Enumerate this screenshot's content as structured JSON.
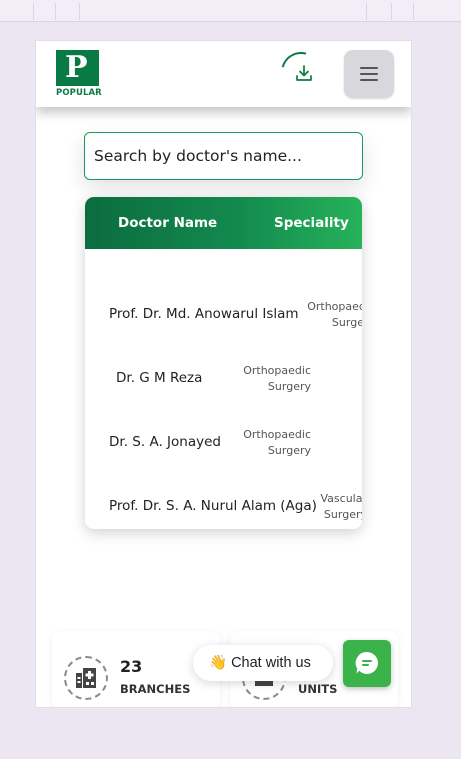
{
  "header": {
    "logo_text": "POPULAR",
    "download_icon": "download-icon",
    "menu_icon": "hamburger-menu-icon"
  },
  "search": {
    "placeholder": "Search by doctor's name..."
  },
  "table": {
    "headers": [
      "Doctor Name",
      "Speciality"
    ],
    "rows": [
      {
        "name": "Prof. Dr. Md. Anowarul Islam",
        "spec1": "Orthopaedic",
        "spec2": "Surgery"
      },
      {
        "name": "Dr. G M Reza",
        "spec1": "Orthopaedic",
        "spec2": "Surgery"
      },
      {
        "name": "Dr. S. A. Jonayed",
        "spec1": "Orthopaedic",
        "spec2": "Surgery"
      },
      {
        "name": "Prof. Dr. S. A. Nurul Alam (Aga)",
        "spec1": "Vascular",
        "spec2": "Surgery"
      }
    ]
  },
  "stats": [
    {
      "number": "23",
      "label": "BRANCHES",
      "icon": "hospital-building-icon"
    },
    {
      "number": "",
      "label": "UNITS",
      "icon": "ambulance-icon"
    }
  ],
  "chat": {
    "pill_text": "👋 Chat with us",
    "button_icon": "chat-bubble-icon"
  },
  "colors": {
    "brand_green": "#0a7a44",
    "chat_green": "#3cb34a",
    "page_bg": "#ece6f2"
  }
}
